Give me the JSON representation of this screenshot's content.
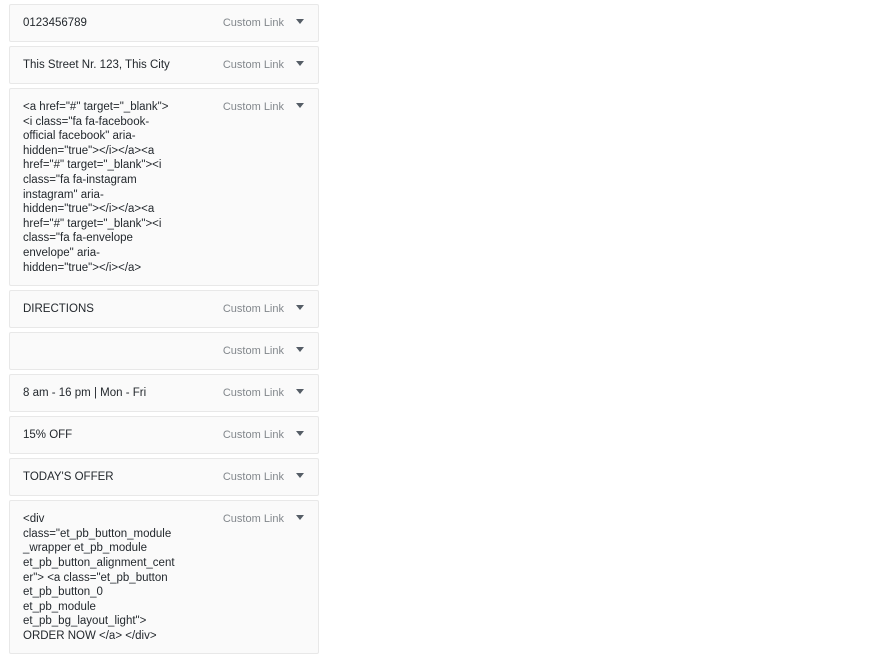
{
  "panel": {
    "name": "menu-structure-list",
    "item_type_label": "Custom Link",
    "toggle_icon": "chevron-down-icon"
  },
  "colors": {
    "page_background": "#ffffff",
    "row_background": "#fafafa",
    "row_border": "#e8e8e8",
    "title_text": "#23282d",
    "meta_text": "#82878c",
    "toggle_icon": "#555d66"
  },
  "items": [
    {
      "title": "0123456789",
      "type": "Custom Link",
      "multiline": false
    },
    {
      "title": "This Street Nr. 123, This City",
      "type": "Custom Link",
      "multiline": false
    },
    {
      "title": "<a href=\"#\" target=\"_blank\"><i class=\"fa fa-facebook-official facebook\" aria-hidden=\"true\"></i></a><a href=\"#\" target=\"_blank\"><i class=\"fa fa-instagram instagram\" aria-hidden=\"true\"></i></a><a href=\"#\" target=\"_blank\"><i class=\"fa fa-envelope envelope\" aria-hidden=\"true\"></i></a>",
      "type": "Custom Link",
      "multiline": true
    },
    {
      "title": "DIRECTIONS",
      "type": "Custom Link",
      "multiline": false
    },
    {
      "title": "",
      "type": "Custom Link",
      "multiline": false
    },
    {
      "title": "8 am - 16 pm | Mon - Fri",
      "type": "Custom Link",
      "multiline": false
    },
    {
      "title": "15% OFF",
      "type": "Custom Link",
      "multiline": false
    },
    {
      "title": "TODAY'S OFFER",
      "type": "Custom Link",
      "multiline": false
    },
    {
      "title": "<div class=\"et_pb_button_module_wrapper et_pb_module et_pb_button_alignment_center\"> <a class=\"et_pb_button et_pb_button_0 et_pb_module et_pb_bg_layout_light\"> ORDER NOW </a> </div>",
      "type": "Custom Link",
      "multiline": true
    }
  ]
}
